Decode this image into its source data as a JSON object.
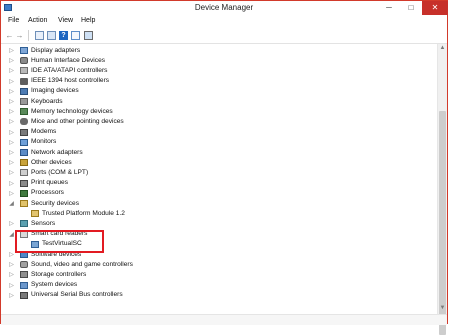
{
  "window": {
    "title": "Device Manager",
    "controls": {
      "minimize": "─",
      "maximize": "□",
      "close": "✕"
    }
  },
  "menu": [
    "File",
    "Action",
    "View",
    "Help"
  ],
  "toolbar": {
    "back_icon": "←",
    "forward_icon": "→"
  },
  "tree": [
    {
      "label": "Display adapters",
      "icon": "display-adapter-icon",
      "expander": "▷"
    },
    {
      "label": "Human Interface Devices",
      "icon": "hid-icon",
      "expander": "▷"
    },
    {
      "label": "IDE ATA/ATAPI controllers",
      "icon": "ide-controller-icon",
      "expander": "▷"
    },
    {
      "label": "IEEE 1394 host controllers",
      "icon": "ieee1394-icon",
      "expander": "▷"
    },
    {
      "label": "Imaging devices",
      "icon": "imaging-device-icon",
      "expander": "▷"
    },
    {
      "label": "Keyboards",
      "icon": "keyboard-icon",
      "expander": "▷"
    },
    {
      "label": "Memory technology devices",
      "icon": "memory-device-icon",
      "expander": "▷"
    },
    {
      "label": "Mice and other pointing devices",
      "icon": "mouse-icon",
      "expander": "▷"
    },
    {
      "label": "Modems",
      "icon": "modem-icon",
      "expander": "▷"
    },
    {
      "label": "Monitors",
      "icon": "monitor-icon",
      "expander": "▷"
    },
    {
      "label": "Network adapters",
      "icon": "network-adapter-icon",
      "expander": "▷"
    },
    {
      "label": "Other devices",
      "icon": "other-devices-icon",
      "expander": "▷"
    },
    {
      "label": "Ports (COM & LPT)",
      "icon": "ports-icon",
      "expander": "▷"
    },
    {
      "label": "Print queues",
      "icon": "printer-icon",
      "expander": "▷"
    },
    {
      "label": "Processors",
      "icon": "processor-icon",
      "expander": "▷"
    },
    {
      "label": "Security devices",
      "icon": "security-device-icon",
      "expander": "◢"
    },
    {
      "label": "Trusted Platform Module 1.2",
      "icon": "tpm-icon",
      "expander": "",
      "child": true
    },
    {
      "label": "Sensors",
      "icon": "sensor-icon",
      "expander": "▷"
    },
    {
      "label": "Smart card readers",
      "icon": "smart-card-reader-icon",
      "expander": "◢"
    },
    {
      "label": "TestVirtualSC",
      "icon": "virtual-smart-card-icon",
      "expander": "",
      "child": true
    },
    {
      "label": "Software devices",
      "icon": "software-device-icon",
      "expander": "▷"
    },
    {
      "label": "Sound, video and game controllers",
      "icon": "sound-controller-icon",
      "expander": "▷"
    },
    {
      "label": "Storage controllers",
      "icon": "storage-controller-icon",
      "expander": "▷"
    },
    {
      "label": "System devices",
      "icon": "system-device-icon",
      "expander": "▷"
    },
    {
      "label": "Universal Serial Bus controllers",
      "icon": "usb-controller-icon",
      "expander": "▷"
    }
  ],
  "scrollbar": {
    "up": "▲",
    "down": "▼"
  },
  "colors": {
    "highlight": "#e21b22",
    "close_button": "#c7302a"
  }
}
